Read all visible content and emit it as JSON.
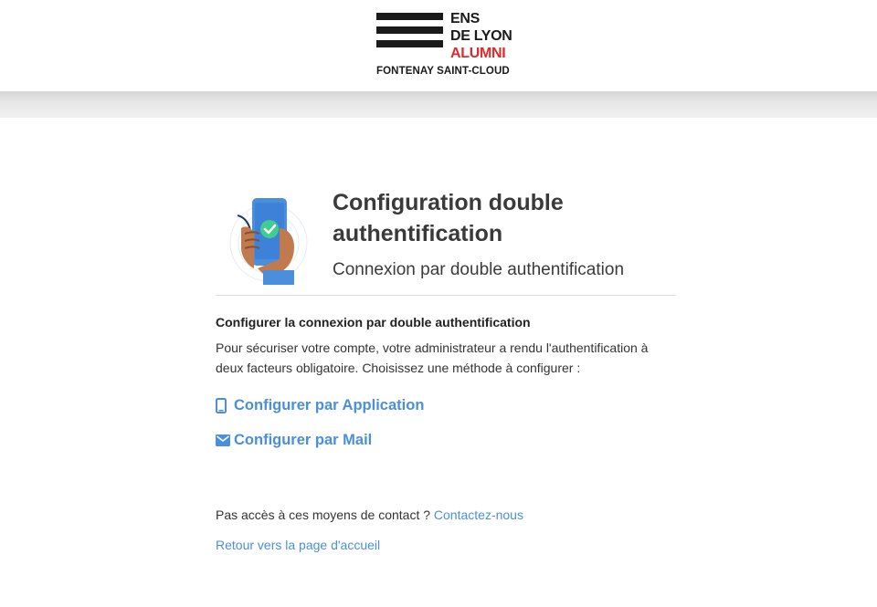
{
  "logo": {
    "line1": "ENS",
    "line2": "DE LYON",
    "line3": "ALUMNI",
    "subtitle": "FONTENAY SAINT-CLOUD"
  },
  "header": {
    "title": "Configuration double authentification",
    "subtitle": "Connexion par double authentification"
  },
  "section": {
    "title": "Configurer la connexion par double authentification",
    "text": "Pour sécuriser votre compte, votre administrateur a rendu l'authentification à deux facteurs obligatoire. Choisissez une méthode à configurer :"
  },
  "methods": [
    {
      "label": "Configurer par Application",
      "icon": "smartphone-icon"
    },
    {
      "label": "Configurer par Mail",
      "icon": "mail-icon"
    }
  ],
  "footer": {
    "contact_text": "Pas accès à ces moyens de contact ?",
    "contact_link": "Contactez-nous",
    "back_link": "Retour vers la page d'accueil"
  },
  "colors": {
    "accent": "#4a8fdc",
    "brand_red": "#e02a2a"
  }
}
